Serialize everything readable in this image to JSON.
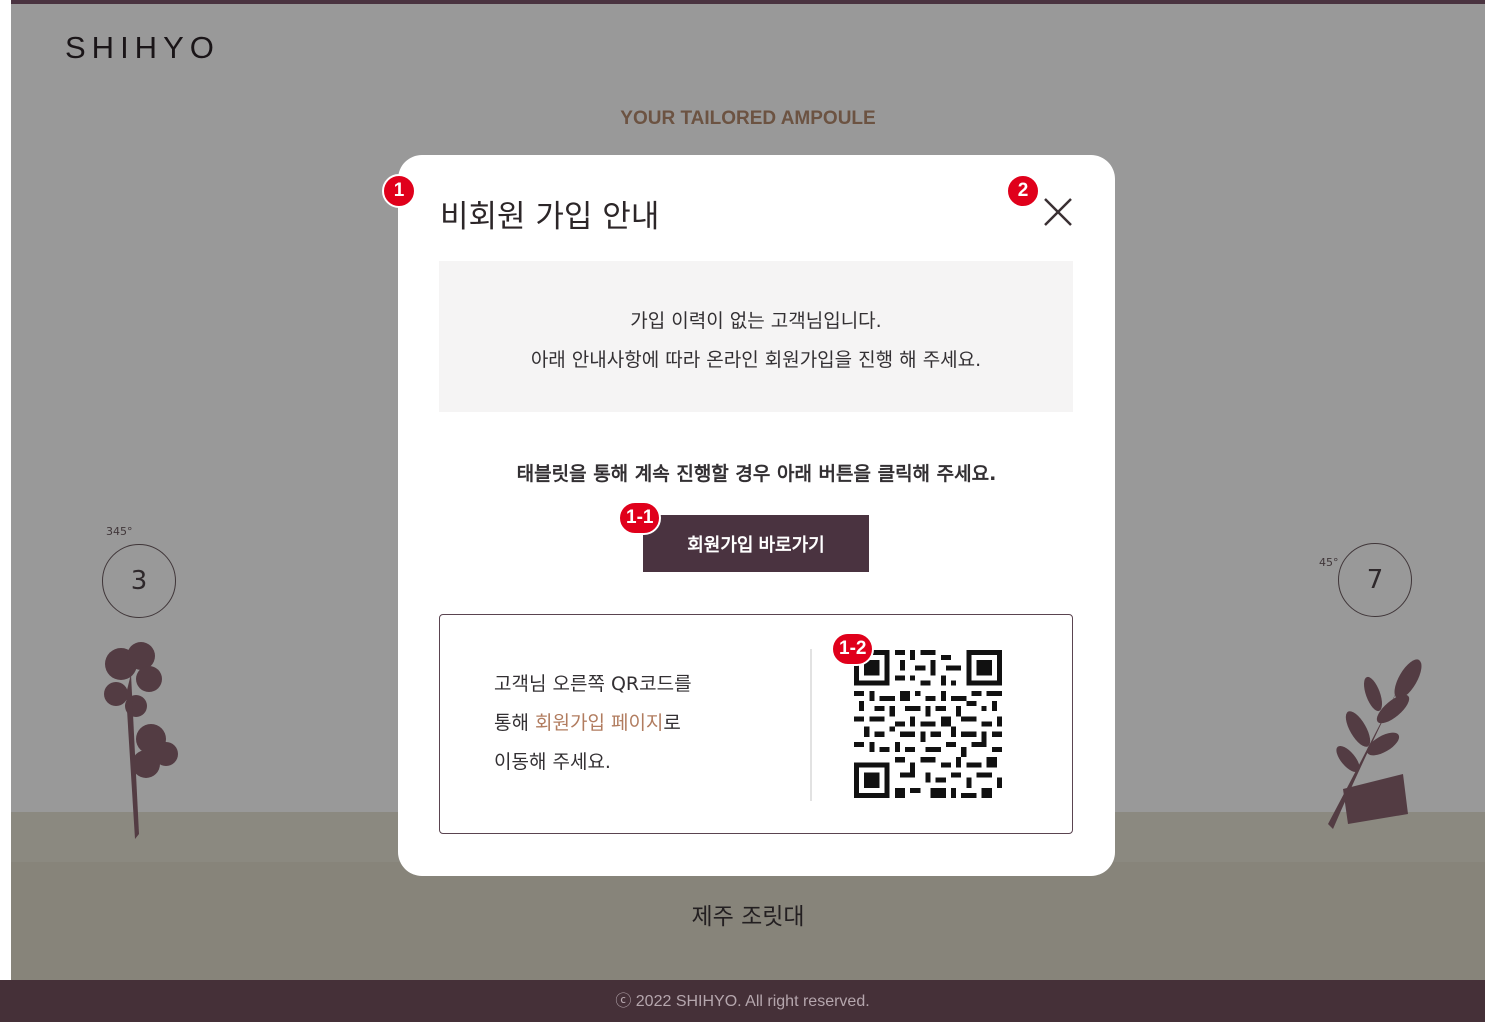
{
  "background": {
    "logo": "SHIHYO",
    "subtitle": "YOUR TAILORED AMPOULE",
    "dial_left": {
      "degree": "345°",
      "number": "3"
    },
    "dial_right": {
      "degree": "45°",
      "number": "7"
    },
    "place_name": "제주 조릿대",
    "footer": "ⓒ 2022 SHIHYO. All right reserved."
  },
  "modal": {
    "title": "비회원 가입 안내",
    "close_icon": "close-icon",
    "notice_line1": "가입 이력이 없는 고객님입니다.",
    "notice_line2": "아래 안내사항에 따라 온라인 회원가입을 진행 해 주세요.",
    "instruction": "태블릿을 통해 계속 진행할 경우 아래 버튼을 클릭해 주세요.",
    "join_button": "회원가입 바로가기",
    "qr_text_line1": "고객님 오른쪽 QR코드를",
    "qr_text_line2_prefix": "통해 ",
    "qr_text_line2_highlight": "회원가입 페이지",
    "qr_text_line2_suffix": "로",
    "qr_text_line3": "이동해 주세요."
  },
  "markers": [
    "1",
    "2",
    "1-1",
    "1-2"
  ],
  "colors": {
    "brand_dark": "#4a3340",
    "accent_text": "#b17c5f",
    "marker_red": "#e0001b"
  }
}
